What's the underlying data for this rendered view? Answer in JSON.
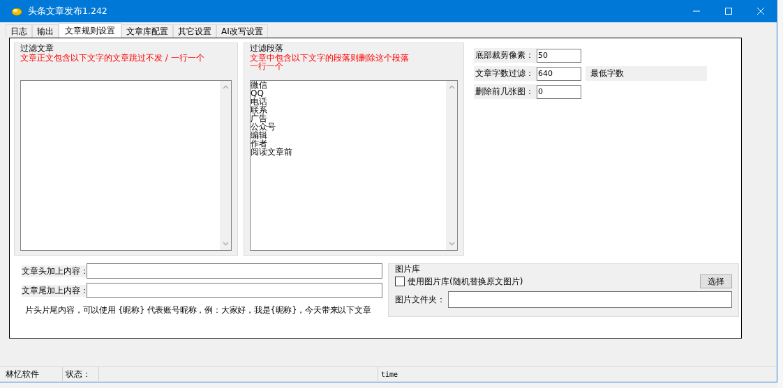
{
  "window": {
    "title": "头条文章发布1.242"
  },
  "tabs": [
    {
      "label": "日志",
      "selected": false
    },
    {
      "label": "输出",
      "selected": false
    },
    {
      "label": "文章规则设置",
      "selected": true
    },
    {
      "label": "文章库配置",
      "selected": false
    },
    {
      "label": "其它设置",
      "selected": false
    },
    {
      "label": "AI改写设置",
      "selected": false
    }
  ],
  "filter_article": {
    "title": "过滤文章",
    "hint_lines": [
      "文章正文包含以下文字的文章跳过不发 / 一行一个"
    ]
  },
  "filter_paragraph": {
    "title": "过滤段落",
    "hint_lines": [
      "文章中包含以下文字的段落则删除这个段落",
      "一行一个"
    ],
    "lines": [
      "微信",
      "QQ",
      "电话",
      "联系",
      "广告",
      "公众号",
      "编辑",
      "作者",
      "阅读文章前"
    ]
  },
  "settings": [
    {
      "label": "底部裁剪像素：",
      "value": "50"
    },
    {
      "label": "文章字数过滤：",
      "value": "640",
      "note": "最低字数"
    },
    {
      "label": "删除前几张图：",
      "value": "0"
    }
  ],
  "content_fields": [
    {
      "label": "文章头加上内容："
    },
    {
      "label": "文章尾加上内容："
    }
  ],
  "content_note": "片头片尾内容，可以使用 {昵称} 代表账号昵称，例：大家好，我是{昵称}，今天带来以下文章",
  "picture_library": {
    "title": "图片库",
    "checkbox": {
      "label": "使用图片库(随机替换原文图片)",
      "checked": false
    },
    "button": "选择",
    "folder_label": "图片文件夹："
  },
  "status_bar": {
    "vendor": "林忆软件",
    "status_label": "状态：",
    "time": "time"
  }
}
